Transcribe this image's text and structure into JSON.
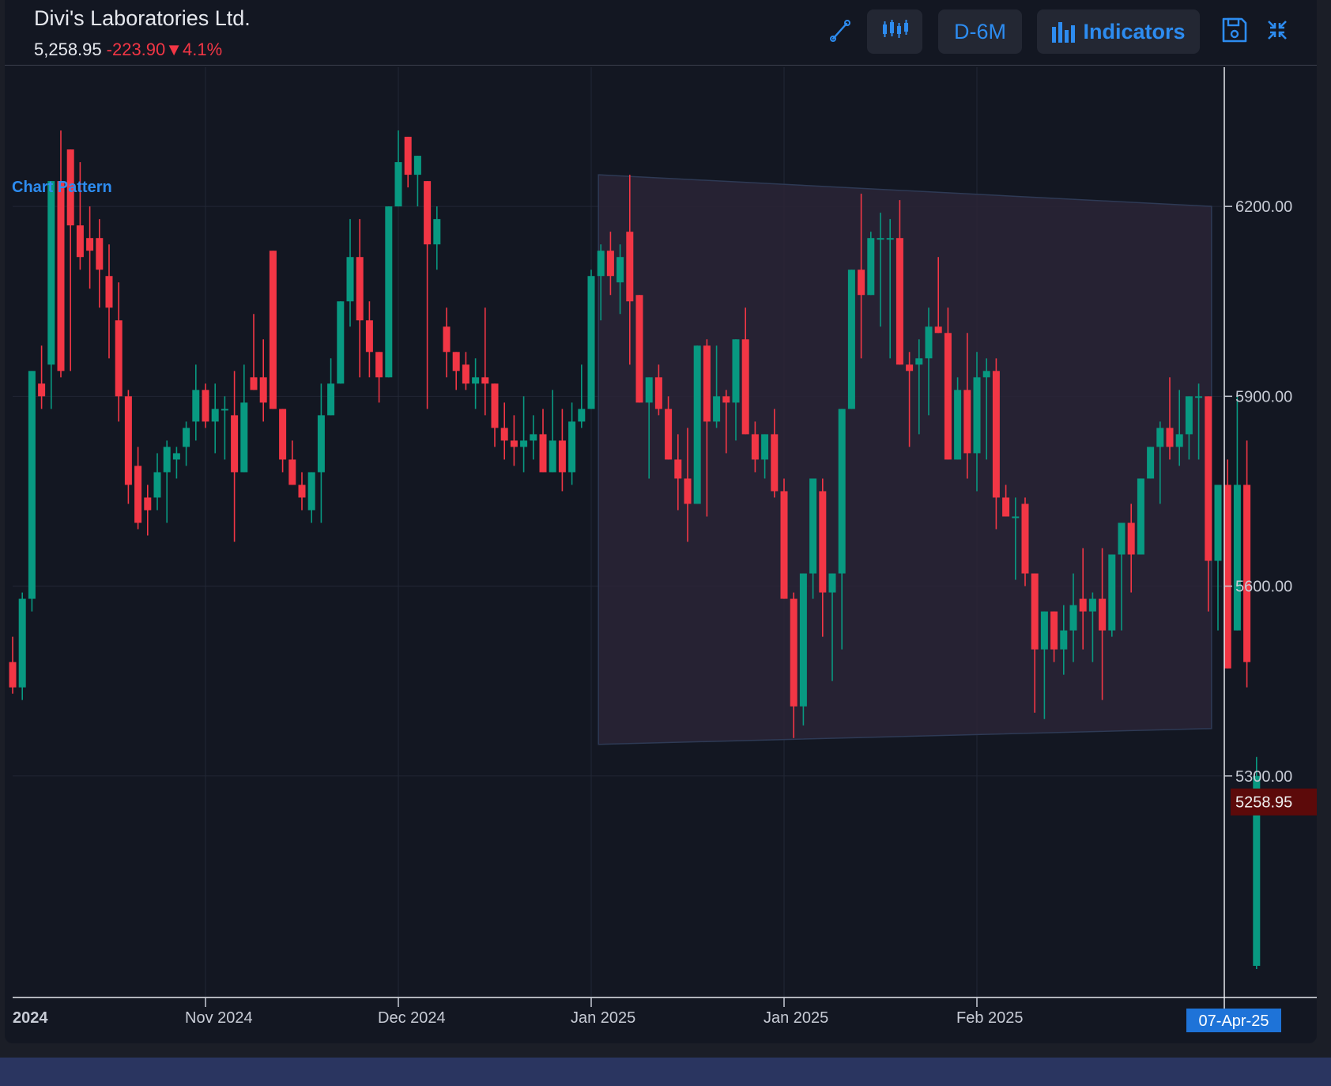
{
  "header": {
    "title": "Divi's Laboratories Ltd.",
    "price": "5,258.95",
    "change": "-223.90",
    "change_pct": "▼4.1%"
  },
  "toolbar": {
    "interval_label": "D-6M",
    "indicators_label": "Indicators"
  },
  "icons": {
    "draw": "pen-line-icon",
    "chart_type": "candlestick-icon",
    "indicators": "bar-chart-icon",
    "save": "floppy-disk-icon",
    "collapse": "collapse-arrows-icon"
  },
  "colors": {
    "up": "#089981",
    "down": "#f23645",
    "accent": "#2d8cf0",
    "pattern_fill": "#2a2536",
    "last_price_bg": "#5c0a0a"
  },
  "chart_data": {
    "type": "candlestick",
    "title": "Divi's Laboratories Ltd.",
    "annotation": "Chart Pattern",
    "y_axis": {
      "ticks": [
        6200,
        5900,
        5600,
        5300
      ],
      "tick_labels": [
        "6200.00",
        "5900.00",
        "5600.00",
        "5300.00"
      ],
      "range": [
        4950,
        6420
      ]
    },
    "x_axis": {
      "labels": [
        {
          "label": "2024",
          "index": 0
        },
        {
          "label": "Nov 2024",
          "index": 20
        },
        {
          "label": "Dec 2024",
          "index": 40
        },
        {
          "label": "Jan 2025",
          "index": 60
        },
        {
          "label": "Jan 2025",
          "index": 80
        },
        {
          "label": "Feb 2025",
          "index": 100
        }
      ],
      "crosshair_label": "07-Apr-25",
      "crosshair_index": 125
    },
    "last_price": {
      "value": 5258.95,
      "label": "5258.95"
    },
    "pattern": {
      "name": "Chart Pattern",
      "start_index": 61,
      "end_index": 124,
      "upper": [
        6250,
        6200
      ],
      "lower": [
        5350,
        5375
      ]
    },
    "candles": [
      [
        5480,
        5520,
        5430,
        5440
      ],
      [
        5440,
        5590,
        5420,
        5580
      ],
      [
        5580,
        5940,
        5560,
        5940
      ],
      [
        5920,
        5980,
        5880,
        5900
      ],
      [
        5950,
        6230,
        5880,
        6240
      ],
      [
        6240,
        6320,
        5930,
        5940
      ],
      [
        6290,
        6140,
        5940,
        6170
      ],
      [
        6170,
        6270,
        6100,
        6120
      ],
      [
        6150,
        6200,
        6070,
        6130
      ],
      [
        6150,
        6180,
        6040,
        6100
      ],
      [
        6090,
        6140,
        5960,
        6040
      ],
      [
        6020,
        6080,
        5860,
        5900
      ],
      [
        5900,
        5910,
        5730,
        5760
      ],
      [
        5790,
        5820,
        5690,
        5700
      ],
      [
        5740,
        5760,
        5680,
        5720
      ],
      [
        5740,
        5810,
        5720,
        5780
      ],
      [
        5780,
        5830,
        5700,
        5820
      ],
      [
        5800,
        5820,
        5770,
        5810
      ],
      [
        5820,
        5860,
        5790,
        5850
      ],
      [
        5860,
        5950,
        5830,
        5910
      ],
      [
        5910,
        5920,
        5850,
        5860
      ],
      [
        5860,
        5920,
        5810,
        5880
      ],
      [
        5880,
        5900,
        5800,
        5880
      ],
      [
        5870,
        5940,
        5670,
        5780
      ],
      [
        5780,
        5950,
        5780,
        5890
      ],
      [
        5930,
        6030,
        5930,
        5910
      ],
      [
        5930,
        5990,
        5860,
        5890
      ],
      [
        6130,
        6130,
        5900,
        5880
      ],
      [
        5880,
        5870,
        5780,
        5800
      ],
      [
        5800,
        5830,
        5760,
        5760
      ],
      [
        5760,
        5780,
        5720,
        5740
      ],
      [
        5720,
        5750,
        5700,
        5780
      ],
      [
        5780,
        5920,
        5700,
        5870
      ],
      [
        5870,
        5960,
        5880,
        5920
      ],
      [
        5920,
        6050,
        5930,
        6050
      ],
      [
        6050,
        6180,
        6010,
        6120
      ],
      [
        6120,
        6180,
        5930,
        6020
      ],
      [
        6020,
        6050,
        5930,
        5970
      ],
      [
        5970,
        5950,
        5890,
        5930
      ],
      [
        5930,
        6200,
        5940,
        6200
      ],
      [
        6200,
        6320,
        6200,
        6270
      ],
      [
        6310,
        6300,
        6230,
        6250
      ],
      [
        6250,
        6280,
        6200,
        6280
      ],
      [
        6240,
        6240,
        5880,
        6140
      ],
      [
        6140,
        6200,
        6100,
        6180
      ],
      [
        6010,
        6040,
        5930,
        5970
      ],
      [
        5970,
        5950,
        5910,
        5940
      ],
      [
        5950,
        5970,
        5910,
        5920
      ],
      [
        5920,
        5960,
        5880,
        5930
      ],
      [
        5930,
        6040,
        5870,
        5920
      ],
      [
        5920,
        5900,
        5820,
        5850
      ],
      [
        5850,
        5890,
        5800,
        5830
      ],
      [
        5830,
        5870,
        5790,
        5820
      ],
      [
        5820,
        5900,
        5780,
        5830
      ],
      [
        5830,
        5870,
        5800,
        5840
      ],
      [
        5840,
        5880,
        5790,
        5780
      ],
      [
        5780,
        5910,
        5780,
        5830
      ],
      [
        5830,
        5880,
        5750,
        5780
      ],
      [
        5780,
        5890,
        5760,
        5860
      ],
      [
        5860,
        5950,
        5850,
        5880
      ],
      [
        5880,
        6100,
        5890,
        6090
      ],
      [
        6090,
        6140,
        6020,
        6130
      ],
      [
        6130,
        6160,
        6060,
        6090
      ],
      [
        6080,
        6140,
        6030,
        6120
      ],
      [
        6160,
        6250,
        5950,
        6050
      ],
      [
        6060,
        5980,
        5930,
        5890
      ],
      [
        5890,
        5920,
        5770,
        5930
      ],
      [
        5930,
        5950,
        5870,
        5880
      ],
      [
        5880,
        5900,
        5820,
        5800
      ],
      [
        5800,
        5840,
        5720,
        5770
      ],
      [
        5770,
        5850,
        5670,
        5730
      ],
      [
        5730,
        5870,
        5750,
        5980
      ],
      [
        5980,
        5990,
        5710,
        5860
      ],
      [
        5860,
        5980,
        5850,
        5900
      ],
      [
        5900,
        5910,
        5810,
        5890
      ],
      [
        5890,
        5930,
        5830,
        5990
      ],
      [
        5990,
        6040,
        5850,
        5840
      ],
      [
        5840,
        5860,
        5780,
        5800
      ],
      [
        5800,
        5830,
        5770,
        5840
      ],
      [
        5840,
        5880,
        5740,
        5750
      ],
      [
        5750,
        5770,
        5600,
        5580
      ],
      [
        5580,
        5590,
        5360,
        5410
      ],
      [
        5410,
        5460,
        5380,
        5620
      ],
      [
        5620,
        5770,
        5580,
        5770
      ],
      [
        5750,
        5770,
        5520,
        5590
      ],
      [
        5590,
        5620,
        5450,
        5620
      ],
      [
        5620,
        5740,
        5500,
        5880
      ],
      [
        5880,
        5950,
        6150,
        6100
      ],
      [
        6100,
        6220,
        5960,
        6060
      ],
      [
        6060,
        6160,
        6080,
        6150
      ],
      [
        6150,
        6190,
        6010,
        6150
      ],
      [
        6150,
        6180,
        5960,
        6150
      ],
      [
        6150,
        6210,
        5960,
        5950
      ],
      [
        5950,
        5970,
        5820,
        5940
      ],
      [
        5950,
        5990,
        5840,
        5960
      ],
      [
        5960,
        6040,
        5870,
        6010
      ],
      [
        6010,
        6120,
        6000,
        6000
      ],
      [
        6000,
        6040,
        5810,
        5800
      ],
      [
        5800,
        5930,
        5820,
        5910
      ],
      [
        5910,
        6000,
        5770,
        5810
      ],
      [
        5810,
        5970,
        5750,
        5930
      ],
      [
        5930,
        5960,
        5800,
        5940
      ],
      [
        5940,
        5960,
        5690,
        5740
      ],
      [
        5740,
        5760,
        5710,
        5710
      ],
      [
        5710,
        5740,
        5610,
        5710
      ],
      [
        5730,
        5740,
        5600,
        5620
      ],
      [
        5620,
        5530,
        5400,
        5500
      ],
      [
        5500,
        5560,
        5390,
        5560
      ],
      [
        5560,
        5550,
        5480,
        5500
      ],
      [
        5500,
        5570,
        5460,
        5530
      ],
      [
        5530,
        5620,
        5480,
        5570
      ],
      [
        5580,
        5660,
        5500,
        5560
      ],
      [
        5560,
        5590,
        5480,
        5580
      ],
      [
        5580,
        5660,
        5420,
        5530
      ],
      [
        5530,
        5650,
        5520,
        5650
      ],
      [
        5650,
        5660,
        5530,
        5700
      ],
      [
        5700,
        5730,
        5590,
        5650
      ],
      [
        5650,
        5770,
        5660,
        5770
      ],
      [
        5770,
        5810,
        5770,
        5820
      ],
      [
        5820,
        5860,
        5730,
        5850
      ],
      [
        5850,
        5930,
        5800,
        5820
      ],
      [
        5820,
        5910,
        5790,
        5840
      ],
      [
        5840,
        5880,
        5800,
        5900
      ],
      [
        5900,
        5920,
        5800,
        5900
      ],
      [
        5900,
        5840,
        5560,
        5640
      ],
      [
        5640,
        5660,
        5530,
        5760
      ],
      [
        5760,
        5800,
        5470,
        5470
      ],
      [
        5530,
        5900,
        5680,
        5760
      ],
      [
        5760,
        5830,
        5440,
        5480
      ],
      [
        5000,
        5330,
        4995,
        5300
      ]
    ]
  }
}
